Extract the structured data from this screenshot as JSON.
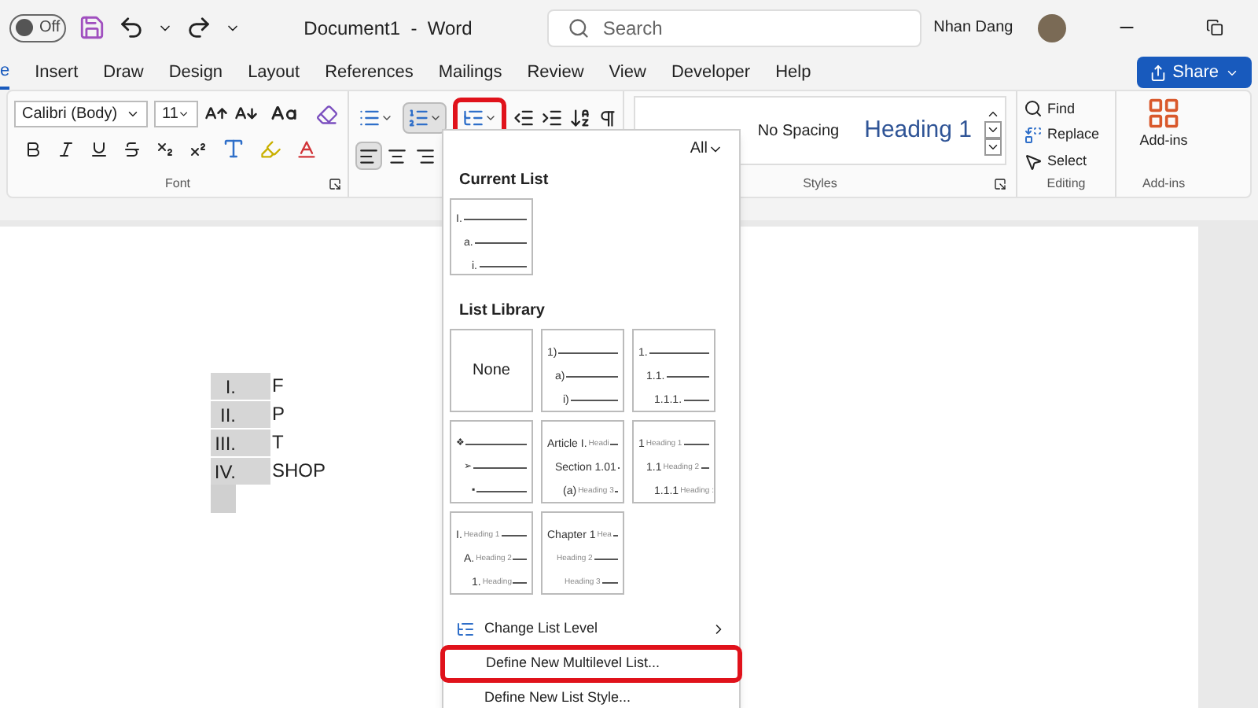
{
  "title_bar": {
    "autosave": {
      "label": "Off",
      "on": false
    },
    "document_title": "Document1  -  Word",
    "search": {
      "placeholder": "Search"
    },
    "user_name": "Nhan Dang"
  },
  "tabs": [
    {
      "label": "e",
      "selected": true
    },
    {
      "label": "Insert",
      "selected": false
    },
    {
      "label": "Draw",
      "selected": false
    },
    {
      "label": "Design",
      "selected": false
    },
    {
      "label": "Layout",
      "selected": false
    },
    {
      "label": "References",
      "selected": false
    },
    {
      "label": "Mailings",
      "selected": false
    },
    {
      "label": "Review",
      "selected": false
    },
    {
      "label": "View",
      "selected": false
    },
    {
      "label": "Developer",
      "selected": false
    },
    {
      "label": "Help",
      "selected": false
    }
  ],
  "share_button": "Share",
  "ribbon": {
    "font": {
      "font_name": "Calibri (Body)",
      "font_size": "11",
      "label": "Font"
    },
    "paragraph": {
      "buttons": [
        {
          "kind": "bullets",
          "selected": false,
          "highlighted": false
        },
        {
          "kind": "numbering",
          "selected": true,
          "highlighted": false
        },
        {
          "kind": "multilevel",
          "selected": false,
          "highlighted": true
        }
      ],
      "align": [
        {
          "kind": "left",
          "selected": true
        },
        {
          "kind": "center",
          "selected": false
        },
        {
          "kind": "right",
          "selected": false
        }
      ]
    },
    "styles": {
      "items": [
        {
          "label": "No Spacing",
          "kind": "normal"
        },
        {
          "label": "Heading 1",
          "kind": "heading"
        }
      ],
      "label": "Styles"
    },
    "editing": {
      "items": [
        {
          "kind": "find",
          "label": "Find"
        },
        {
          "kind": "replace",
          "label": "Replace"
        },
        {
          "kind": "select",
          "label": "Select"
        }
      ],
      "label": "Editing"
    },
    "addins": {
      "button": "Add-ins",
      "label": "Add-ins"
    }
  },
  "document": {
    "list": [
      {
        "number": "I.",
        "text": "F"
      },
      {
        "number": "II.",
        "text": "P"
      },
      {
        "number": "III.",
        "text": "T"
      },
      {
        "number": "IV.",
        "text": "SHOP"
      }
    ]
  },
  "dropdown": {
    "filter": "All",
    "current_list": {
      "title": "Current List",
      "lines": [
        {
          "num": "I."
        },
        {
          "num": "a."
        },
        {
          "num": "i."
        }
      ]
    },
    "library": {
      "title": "List Library",
      "items": [
        {
          "kind": "text",
          "label": "None"
        },
        {
          "kind": "lines",
          "lines": [
            {
              "num": "1)"
            },
            {
              "num": "a)"
            },
            {
              "num": "i)"
            }
          ]
        },
        {
          "kind": "lines",
          "lines": [
            {
              "num": "1."
            },
            {
              "num": "1.1."
            },
            {
              "num": "1.1.1."
            }
          ]
        },
        {
          "kind": "bullets",
          "lines": [
            {
              "num": "❖"
            },
            {
              "num": "➢"
            },
            {
              "num": "▪"
            }
          ]
        },
        {
          "kind": "lines",
          "lines": [
            {
              "num": "Article I.",
              "heading": "Headi"
            },
            {
              "num": "Section 1.01"
            },
            {
              "num": "(a)",
              "heading": "Heading 3"
            }
          ]
        },
        {
          "kind": "lines",
          "lines": [
            {
              "num": "1",
              "heading": "Heading 1"
            },
            {
              "num": "1.1",
              "heading": "Heading 2"
            },
            {
              "num": "1.1.1",
              "heading": "Heading :"
            }
          ]
        },
        {
          "kind": "lines",
          "lines": [
            {
              "num": "I.",
              "heading": "Heading 1"
            },
            {
              "num": "A.",
              "heading": "Heading 2"
            },
            {
              "num": "1.",
              "heading": "Heading"
            }
          ]
        },
        {
          "kind": "lines",
          "lines": [
            {
              "num": "Chapter 1",
              "heading": "Hea"
            },
            {
              "heading": "Heading 2"
            },
            {
              "heading": "Heading 3"
            }
          ]
        }
      ]
    },
    "menu_items": [
      {
        "kind": "submenu",
        "label": "Change List Level",
        "highlighted": false
      },
      {
        "kind": "plain",
        "label": "Define New Multilevel List...",
        "highlighted": true
      },
      {
        "kind": "plain",
        "label": "Define New List Style...",
        "highlighted": false
      }
    ]
  }
}
